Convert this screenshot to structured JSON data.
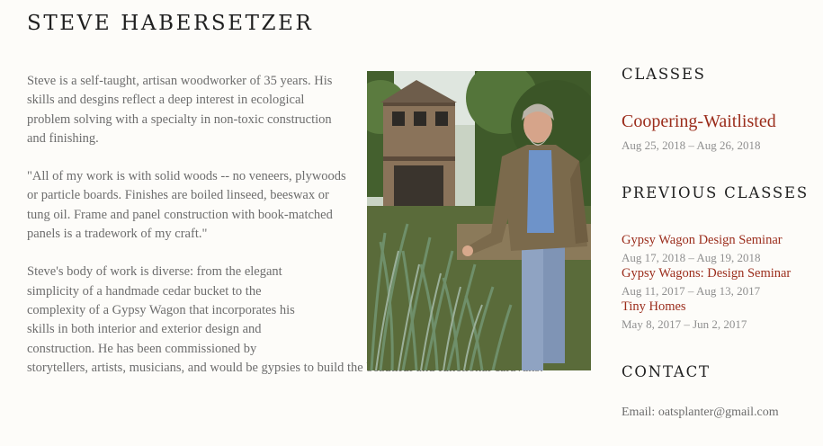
{
  "header": {
    "title": "STEVE HABERSETZER"
  },
  "bio": {
    "paragraphs": [
      "Steve is a self-taught, artisan woodworker of 35 years. His skills and desgins reflect a deep interest in ecological problem solving with a specialty in non-toxic construction and finishing.",
      "\"All of my work is with solid woods -- no veneers, plywoods or particle boards. Finishes are boiled linseed, beeswax or tung oil. Frame and panel construction with book-matched panels is a tradework of my craft.\""
    ],
    "last_paragraph_start": "Steve's body of work is diverse: from the elegant simplicity of a handmade cedar bucket to the complexity of a Gypsy Wagon that incorporates his skills in both interior and exterior design and construction. He has been commissioned by",
    "last_paragraph_end": "storytellers, artists, musicians, and would be gypsies to build the beautiful and functional caravans."
  },
  "sidebar": {
    "classes_heading": "CLASSES",
    "current_class": {
      "title": "Coopering-Waitlisted",
      "dates": "Aug 25, 2018 – Aug 26, 2018"
    },
    "previous_heading": "PREVIOUS CLASSES",
    "previous_classes": [
      {
        "title": "Gypsy Wagon Design Seminar",
        "dates": "Aug 17, 2018 – Aug 19, 2018"
      },
      {
        "title": "Gypsy Wagons: Design Seminar",
        "dates": "Aug 11, 2017 – Aug 13, 2017"
      },
      {
        "title": "Tiny Homes",
        "dates": "May 8, 2017 – Jun 2, 2017"
      }
    ],
    "contact_heading": "CONTACT",
    "contact_email": "Email: oatsplanter@gmail.com"
  },
  "colors": {
    "background": "#fdfcf9",
    "link": "#9b2d1c",
    "heading": "#1f1f1f",
    "body_text": "#6d6d6d",
    "muted": "#8f8f8f"
  }
}
